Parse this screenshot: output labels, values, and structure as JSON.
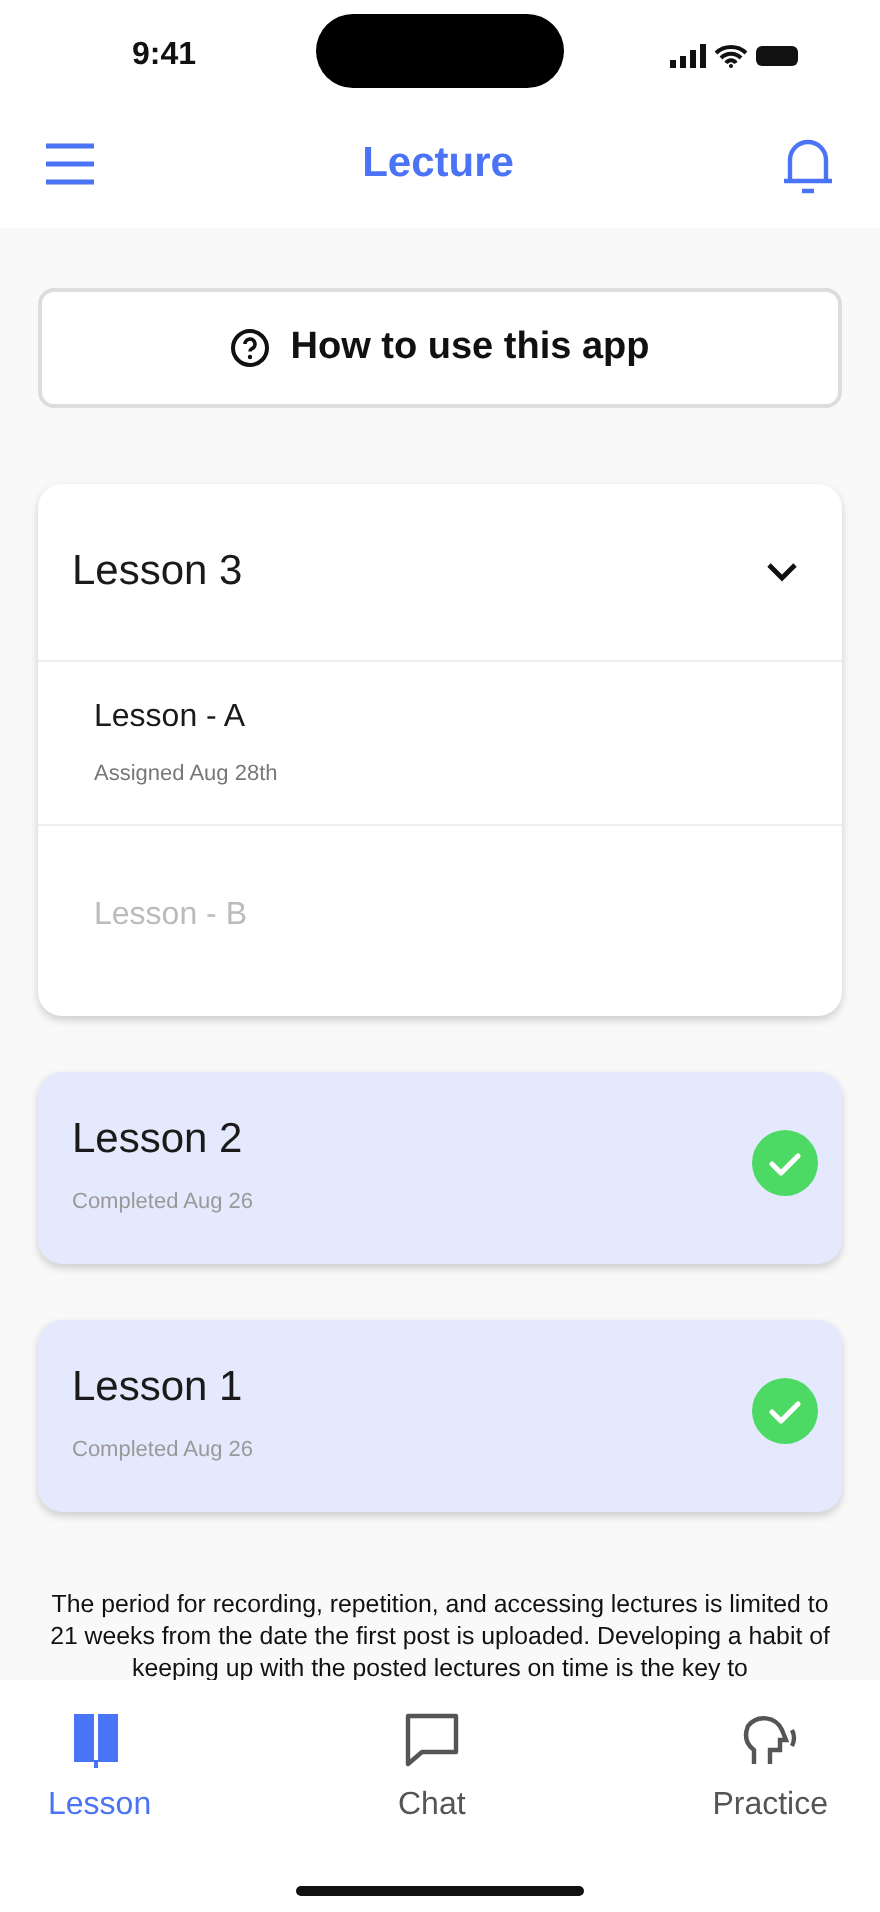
{
  "status_bar": {
    "time": "9:41"
  },
  "header": {
    "title": "Lecture"
  },
  "help_button": {
    "label": "How to use this app"
  },
  "lessons": [
    {
      "title": "Lesson 3",
      "kind": "open",
      "expanded": true,
      "items": [
        {
          "title": "Lesson - A",
          "subtitle": "Assigned Aug 28th",
          "disabled": false
        },
        {
          "title": "Lesson - B",
          "disabled": true
        }
      ]
    },
    {
      "title": "Lesson 2",
      "subtitle": "Completed Aug 26",
      "kind": "done"
    },
    {
      "title": "Lesson 1",
      "subtitle": "Completed Aug 26",
      "kind": "done"
    }
  ],
  "notice": "The period for recording, repetition, and accessing lectures is limited to 21 weeks from the date the first post is uploaded. Developing a habit of keeping up with the posted lectures on time is the key to",
  "tabs": [
    {
      "label": "Lesson",
      "kind": "book",
      "selected": true
    },
    {
      "label": "Chat",
      "kind": "chat",
      "selected": false
    },
    {
      "label": "Practice",
      "kind": "speak",
      "selected": false
    }
  ]
}
